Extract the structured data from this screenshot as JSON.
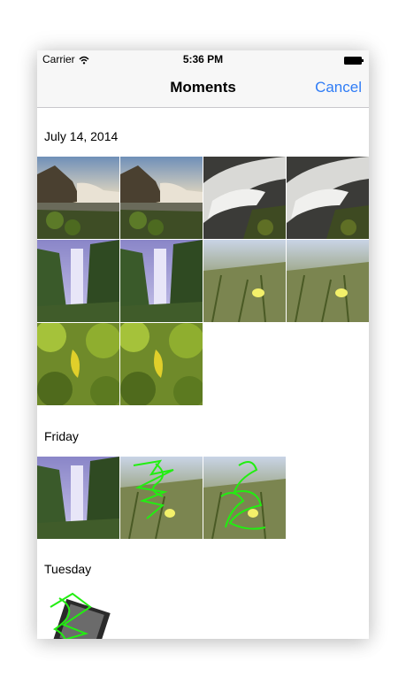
{
  "status_bar": {
    "carrier": "Carrier",
    "time": "5:36 PM"
  },
  "nav": {
    "title": "Moments",
    "cancel_label": "Cancel"
  },
  "colors": {
    "accent": "#2f7cf6",
    "sketch": "#22ee11"
  },
  "sections": [
    {
      "title": "July 14, 2014",
      "photos": [
        "waterfall-sunset",
        "waterfall-sunset",
        "rapids-bw",
        "rapids-bw",
        "waterfall-purple",
        "waterfall-purple",
        "meadow-flower",
        "meadow-flower",
        "yellow-leaf",
        "yellow-leaf"
      ]
    },
    {
      "title": "Friday",
      "photos": [
        "waterfall-purple",
        "meadow-flower-sketch",
        "meadow-flower-sketch"
      ]
    },
    {
      "title": "Tuesday",
      "photos": [
        "rotated-sketch"
      ]
    }
  ]
}
